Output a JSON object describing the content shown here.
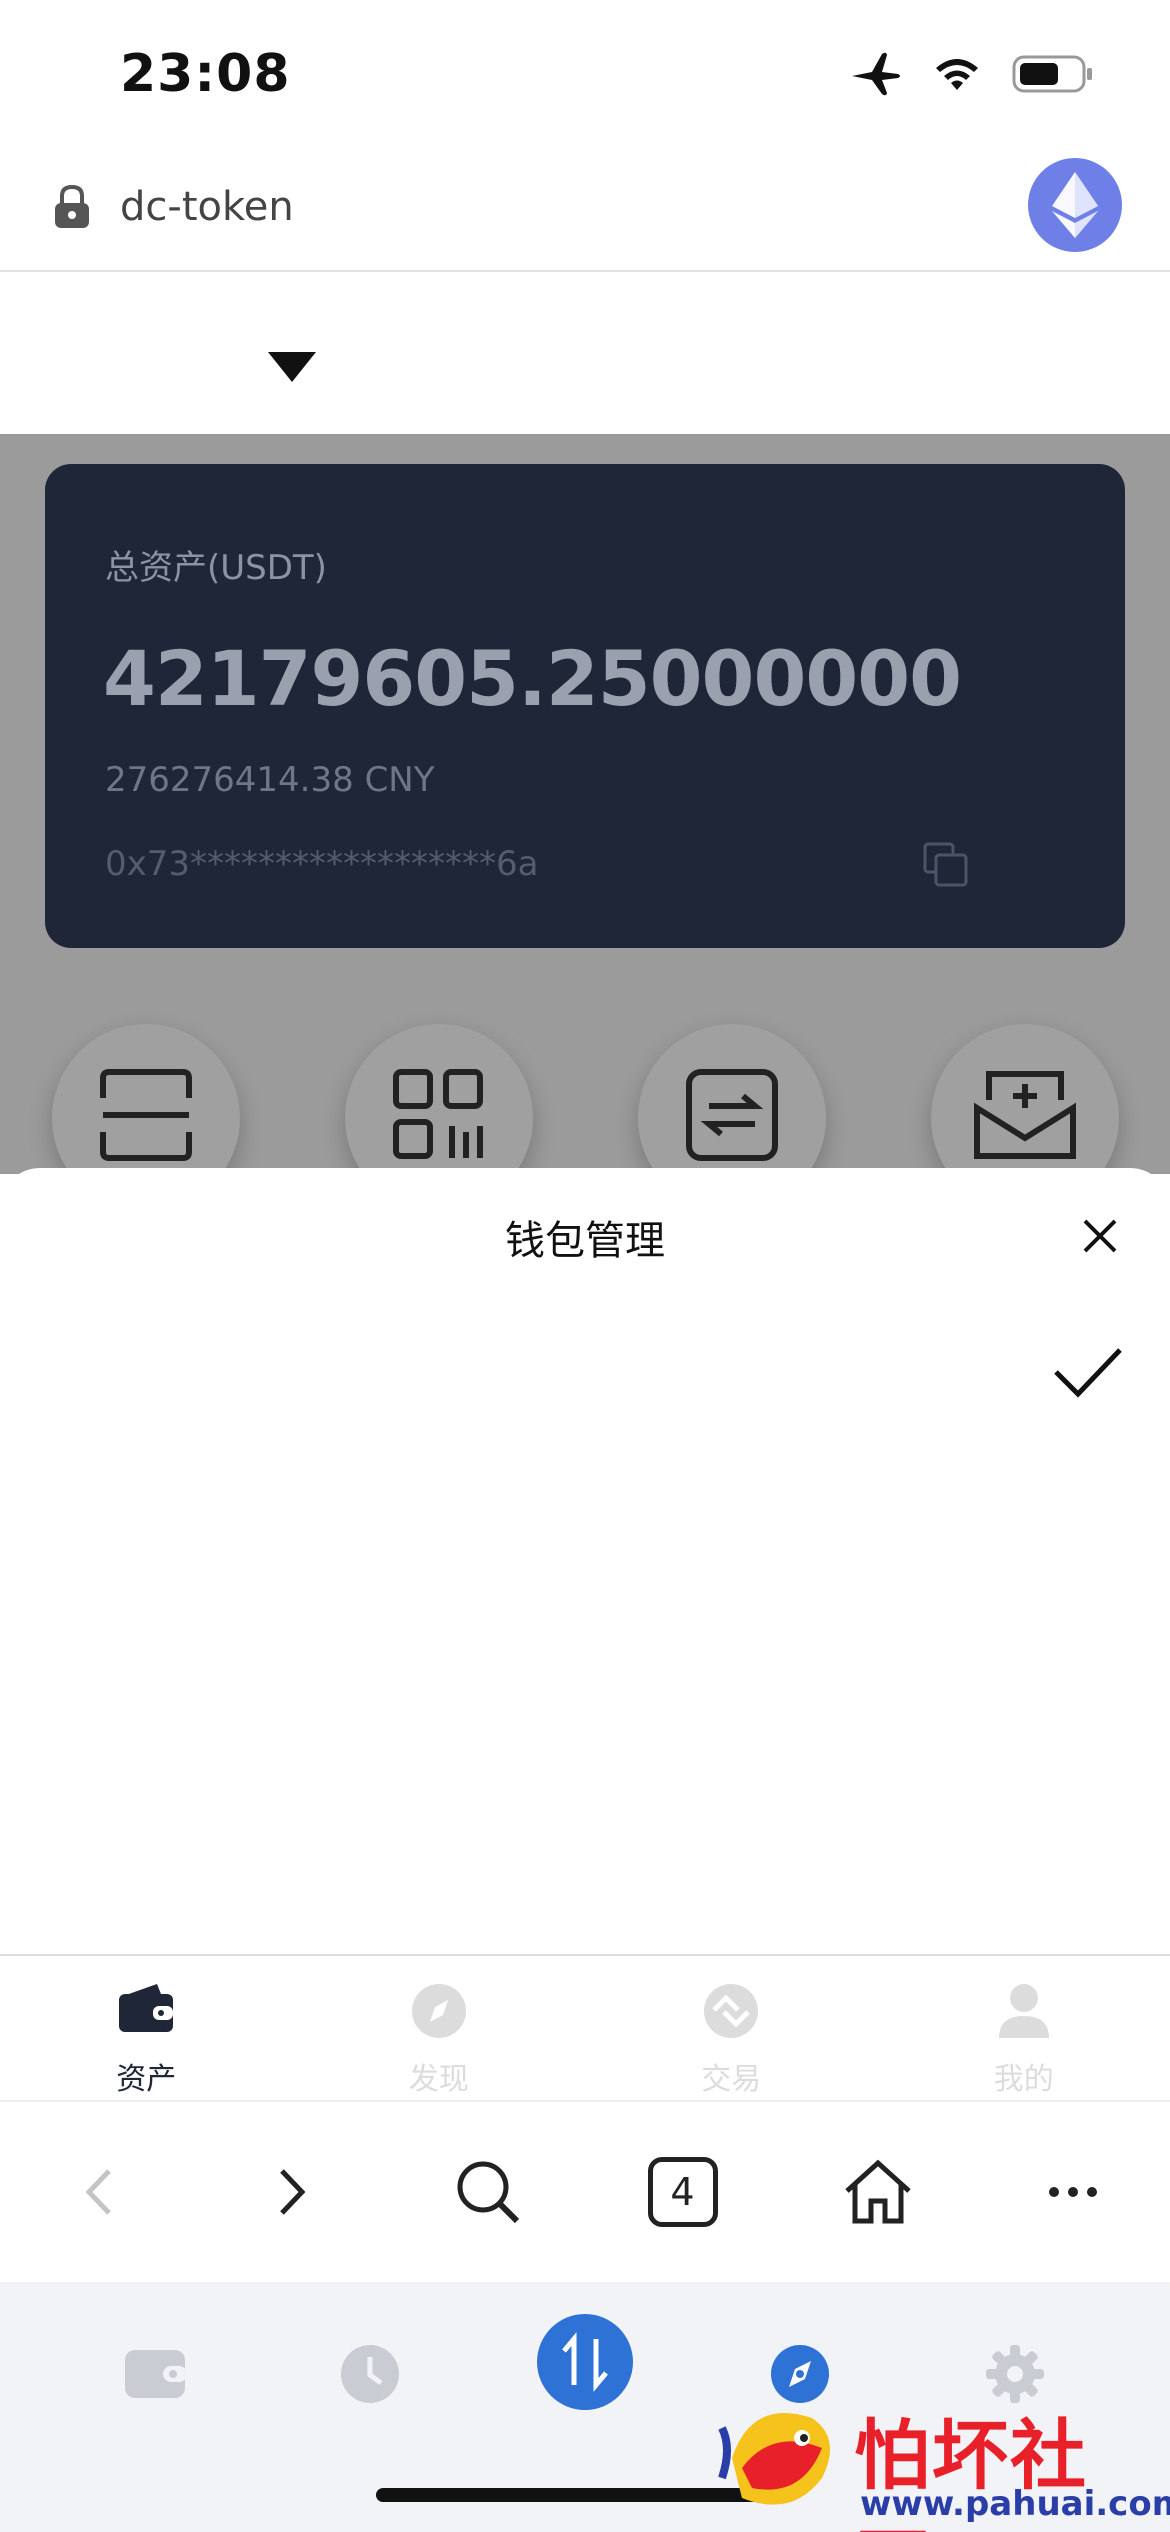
{
  "status_bar": {
    "time": "23:08"
  },
  "url_bar": {
    "url": "dc-token"
  },
  "asset_card": {
    "label": "总资产(USDT)",
    "amount": "42179605.25000000",
    "cny": "276276414.38 CNY",
    "address": "0x73******************6a"
  },
  "quick_actions": [
    {
      "icon": "scan-icon"
    },
    {
      "icon": "qr-code-icon"
    },
    {
      "icon": "transfer-icon"
    },
    {
      "icon": "receive-icon"
    }
  ],
  "sheet": {
    "title": "钱包管理"
  },
  "app_tabs": [
    {
      "label": "资产",
      "icon": "wallet-icon",
      "active": true
    },
    {
      "label": "发现",
      "icon": "compass-icon",
      "active": false
    },
    {
      "label": "交易",
      "icon": "exchange-icon",
      "active": false
    },
    {
      "label": "我的",
      "icon": "profile-icon",
      "active": false
    }
  ],
  "browser_nav": {
    "tab_count": "4"
  },
  "dock": {
    "items": [
      "wallet-icon",
      "history-icon",
      "swap-icon",
      "discover-icon",
      "settings-icon"
    ],
    "accent": "#2f72d6"
  },
  "watermark": {
    "text": "怕坏社区",
    "url": "www.pahuai.com"
  },
  "colors": {
    "card_bg": "#1f2638",
    "eth": "#6f7fe8",
    "dim": "#9b9b9b"
  }
}
